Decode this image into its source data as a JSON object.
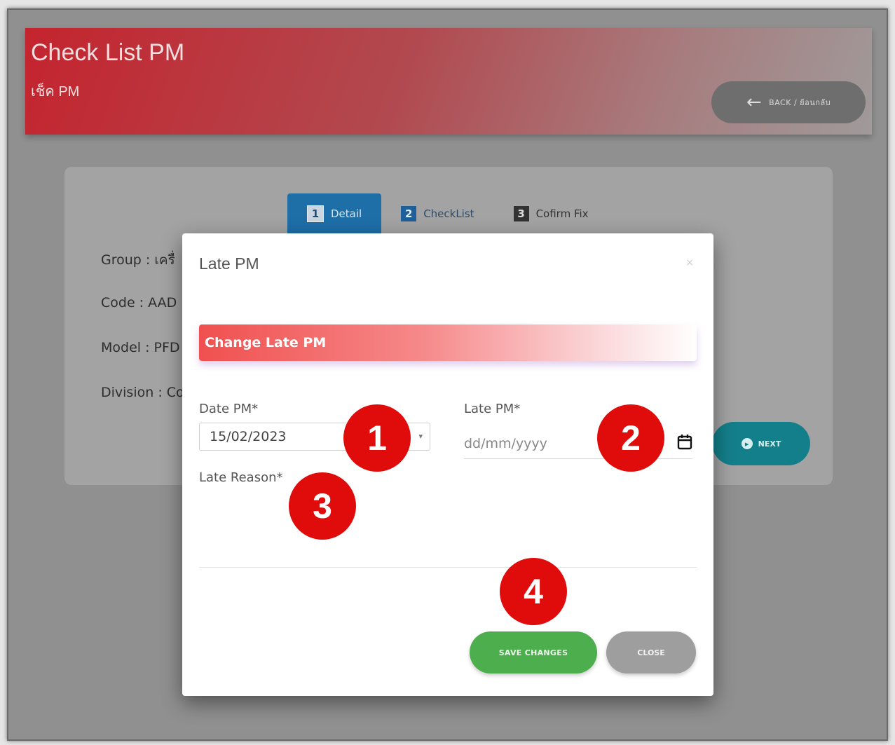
{
  "header": {
    "title": "Check List PM",
    "subtitle": "เช็ค PM",
    "back_label": "BACK / ย้อนกลับ"
  },
  "steps": [
    {
      "num": "1",
      "label": "Detail"
    },
    {
      "num": "2",
      "label": "CheckList"
    },
    {
      "num": "3",
      "label": "Cofirm Fix"
    }
  ],
  "details": {
    "group": "Group : เครื่",
    "code": "Code : AAD",
    "model": "Model : PFD",
    "division": "Division : Co"
  },
  "next_label": "NEXT",
  "modal": {
    "title": "Late PM",
    "close_icon": "×",
    "banner": "Change Late PM",
    "date_pm_label": "Date PM*",
    "date_pm_value": "15/02/2023",
    "late_pm_label": "Late PM*",
    "late_pm_placeholder": "dd/mm/yyyy",
    "late_reason_label": "Late Reason*",
    "save_label": "SAVE CHANGES",
    "close_label": "CLOSE"
  },
  "markers": [
    "1",
    "2",
    "3",
    "4"
  ],
  "colors": {
    "header_red": "#c4242e",
    "tab_blue": "#1e6ea8",
    "next_teal": "#137f8a",
    "save_green": "#4cae4c",
    "marker_red": "#e00c0c"
  }
}
